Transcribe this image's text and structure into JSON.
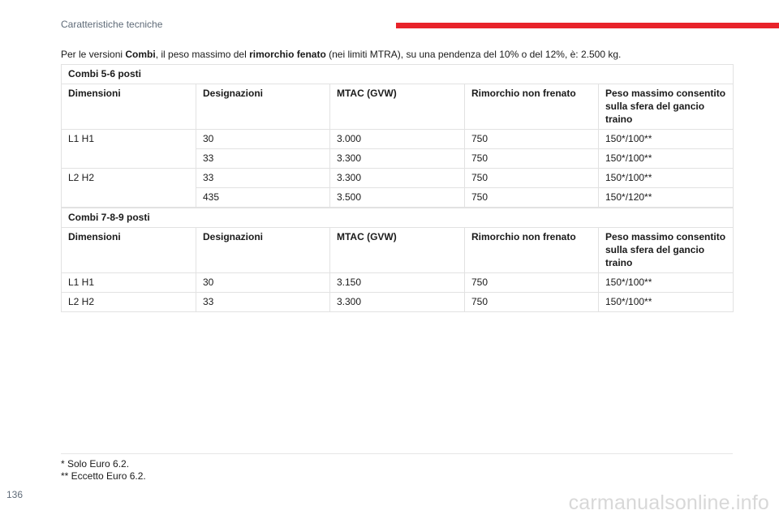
{
  "header": {
    "section_title": "Caratteristiche tecniche",
    "accent_color": "#e8232a"
  },
  "intro": {
    "part1": "Per le versioni ",
    "bold1": "Combi",
    "part2": ", il peso massimo del ",
    "bold2": "rimorchio fenato",
    "part3": " (nei limiti MTRA), su una pendenza del 10% o del 12%, è: 2.500 kg."
  },
  "columns": [
    "Dimensioni",
    "Designazioni",
    "MTAC (GVW)",
    "Rimorchio non frenato",
    "Peso massimo consentito sulla sfera del gancio traino"
  ],
  "table1": {
    "title": "Combi 5-6 posti",
    "rows": [
      [
        "L1 H1",
        "30",
        "3.000",
        "750",
        "150*/100**"
      ],
      [
        "",
        "33",
        "3.300",
        "750",
        "150*/100**"
      ],
      [
        "L2 H2",
        "33",
        "3.300",
        "750",
        "150*/100**"
      ],
      [
        "",
        "435",
        "3.500",
        "750",
        "150*/120**"
      ]
    ]
  },
  "table2": {
    "title": "Combi 7-8-9 posti",
    "rows": [
      [
        "L1 H1",
        "30",
        "3.150",
        "750",
        "150*/100**"
      ],
      [
        "L2 H2",
        "33",
        "3.300",
        "750",
        "150*/100**"
      ]
    ]
  },
  "footnotes": [
    "* Solo Euro 6.2.",
    "** Eccetto Euro 6.2."
  ],
  "page_number": "136",
  "watermark": "carmanualsonline.info"
}
